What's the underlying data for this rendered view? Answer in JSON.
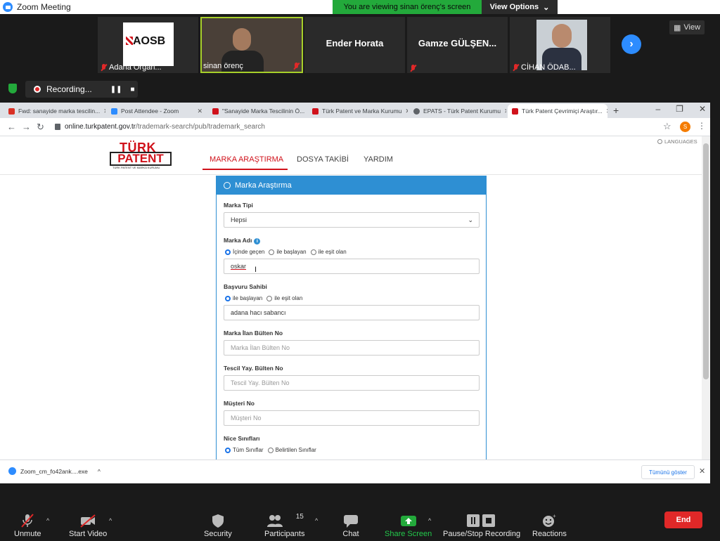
{
  "zoom": {
    "window_title": "Zoom Meeting",
    "viewing_banner": "You are viewing sinan örenç's screen",
    "view_options": "View Options",
    "view_label": "View",
    "participants": [
      {
        "name": "Adana Organ...",
        "video": "logo",
        "logo_text": "AOSB"
      },
      {
        "name": "sinan örenç",
        "video": "camera"
      },
      {
        "name": "Ender Horata",
        "video": "off"
      },
      {
        "name": "Gamze GÜLŞEN...",
        "video": "off"
      },
      {
        "name": "CİHAN ÖDAB...",
        "video": "photo"
      }
    ],
    "recording_label": "Recording...",
    "toolbar": {
      "unmute": "Unmute",
      "start_video": "Start Video",
      "security": "Security",
      "participants": "Participants",
      "participants_count": "15",
      "chat": "Chat",
      "share_screen": "Share Screen",
      "pause_stop_recording": "Pause/Stop Recording",
      "reactions": "Reactions",
      "end": "End"
    }
  },
  "browser": {
    "tabs": [
      {
        "title": "Fwd: sanayide marka tescilin...",
        "color": "#d93025"
      },
      {
        "title": "Post Attendee - Zoom",
        "color": "#2d8cff"
      },
      {
        "title": "\"Sanayide Marka Tescilinin Ö...",
        "color": "#d0121b"
      },
      {
        "title": "Türk Patent ve Marka Kurumu",
        "color": "#d0121b"
      },
      {
        "title": "EPATS - Türk Patent Kurumu",
        "color": "#5f6368"
      },
      {
        "title": "Türk Patent Çevrimiçi Araştır...",
        "color": "#d0121b"
      }
    ],
    "url_host": "online.turkpatent.gov.tr",
    "url_path": "/trademark-search/pub/trademark_search",
    "profile_initial": "S",
    "download_file": "Zoom_cm_fo42ank....exe",
    "download_show_all": "Tümünü göster"
  },
  "site": {
    "logo_line1": "TÜRK",
    "logo_line2": "PATENT",
    "logo_line3": "TÜRK PATENT VE MARKA KURUMU",
    "languages": "LANGUAGES",
    "nav": [
      "MARKA ARAŞTIRMA",
      "DOSYA TAKİBİ",
      "YARDIM"
    ],
    "panel_title": "Marka Araştırma",
    "form": {
      "marka_tipi_label": "Marka Tipi",
      "marka_tipi_value": "Hepsi",
      "marka_adi_label": "Marka Adı",
      "marka_adi_options": [
        "İçinde geçen",
        "ile başlayan",
        "ile eşit olan"
      ],
      "marka_adi_value": "oskar",
      "basvuru_sahibi_label": "Başvuru Sahibi",
      "basvuru_sahibi_options": [
        "ile başlayan",
        "ile eşit olan"
      ],
      "basvuru_sahibi_value": "adana hacı sabancı",
      "bulten_label": "Marka İlan Bülten No",
      "bulten_placeholder": "Marka İlan Bülten No",
      "tescil_label": "Tescil Yay. Bülten No",
      "tescil_placeholder": "Tescil Yay. Bülten No",
      "musteri_label": "Müşteri No",
      "musteri_placeholder": "Müşteri No",
      "nice_label": "Nice Sınıfları",
      "nice_options": [
        "Tüm Sınıflar",
        "Belirtilen Sınıflar"
      ]
    }
  }
}
